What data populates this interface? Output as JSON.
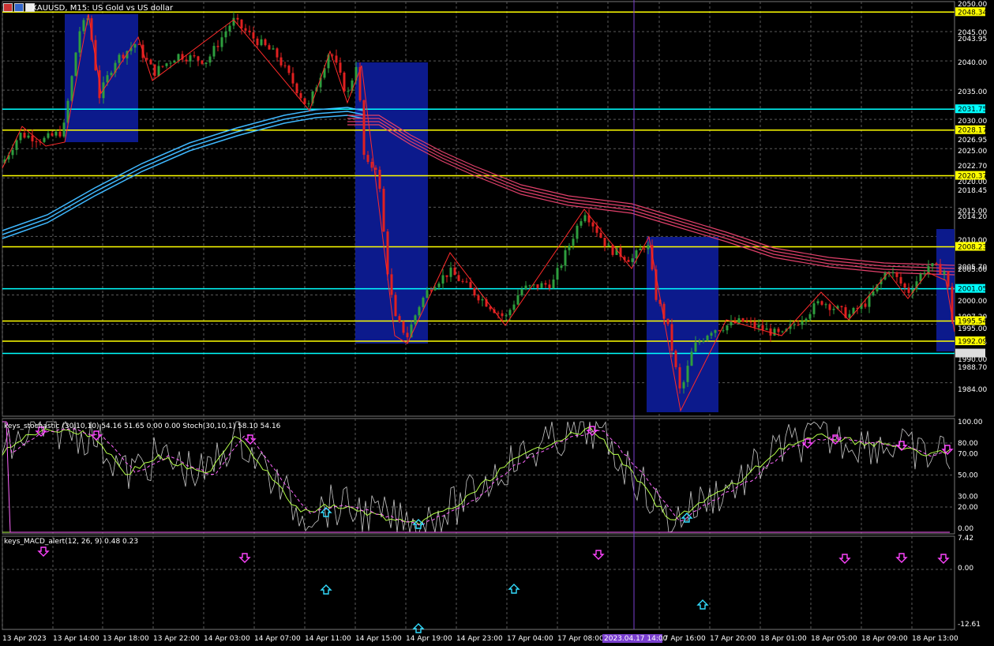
{
  "window": {
    "symbol_title": "XAUUSD, M15:  US Gold vs US dollar"
  },
  "stoch_panel": {
    "title": "keys_stochastic (30,10,10) 54.16 51.65 0.00 0.00 Stoch(30,10,1) 58.10 54.16"
  },
  "macd_panel": {
    "title": "keys_MACD_alert(12, 26, 9) 0.48 0.23"
  },
  "price_axis": {
    "labels": [
      "2050.00",
      "2045.00",
      "2043.95",
      "2040.00",
      "2035.00",
      "2030.00",
      "2026.95",
      "2025.00",
      "2022.70",
      "2020.00",
      "2018.45",
      "2015.00",
      "2014.20",
      "2010.00",
      "2005.00",
      "2005.70",
      "2000.00",
      "1997.20",
      "1995.00",
      "1992.95",
      "1990.00",
      "1988.70",
      "1984.00"
    ],
    "highlight_labels": [
      {
        "text": "2048.34",
        "color": "#ffff00",
        "fg": "#000000"
      },
      {
        "text": "2031.75",
        "color": "#00ffff",
        "fg": "#000000"
      },
      {
        "text": "2028.17",
        "color": "#ffff00",
        "fg": "#000000"
      },
      {
        "text": "2020.37",
        "color": "#ffff00",
        "fg": "#000000"
      },
      {
        "text": "2008.23",
        "color": "#ffff00",
        "fg": "#000000"
      },
      {
        "text": "2001.05",
        "color": "#00ffff",
        "fg": "#000000"
      },
      {
        "text": "1995.54",
        "color": "#ffff00",
        "fg": "#000000"
      },
      {
        "text": "1992.09",
        "color": "#ffff00",
        "fg": "#000000"
      }
    ]
  },
  "stoch_axis": {
    "labels": [
      "100.00",
      "80.00",
      "70.00",
      "50.00",
      "30.00",
      "20.00",
      "0.00"
    ]
  },
  "macd_axis": {
    "labels": [
      "7.42",
      "0.00",
      "-12.61"
    ]
  },
  "time_axis": {
    "labels": [
      "13 Apr 2023",
      "13 Apr 14:00",
      "13 Apr 18:00",
      "13 Apr 22:00",
      "14 Apr 03:00",
      "14 Apr 07:00",
      "14 Apr 11:00",
      "14 Apr 15:00",
      "14 Apr 19:00",
      "14 Apr 23:00",
      "17 Apr 04:00",
      "17 Apr 08:00",
      "17 Apr 16:00",
      "17 Apr 20:00",
      "18 Apr 01:00",
      "18 Apr 05:00",
      "18 Apr 09:00",
      "18 Apr 13:00"
    ],
    "crosshair_label": "2023.04.17 14:00"
  },
  "colors": {
    "background": "#000000",
    "grid": "#5a5a5a",
    "bull_candle": "#2e9e3e",
    "bear_candle": "#e02020",
    "yellow_level": "#ffff00",
    "cyan_level": "#00ffff",
    "zone": "#0c1a8c",
    "ma_blue": "#3fb8ff",
    "ma_red": "#e0406a",
    "zigzag": "#ff2a2a",
    "crosshair": "#7a3fcf",
    "stoch_main": "#c8c8c8",
    "stoch_signal": "#b5ff4a",
    "macd_main": "#b5ff4a",
    "macd_signal": "#ff66ff",
    "arrow_down": "#ff44ff",
    "arrow_up": "#33ddff"
  }
}
